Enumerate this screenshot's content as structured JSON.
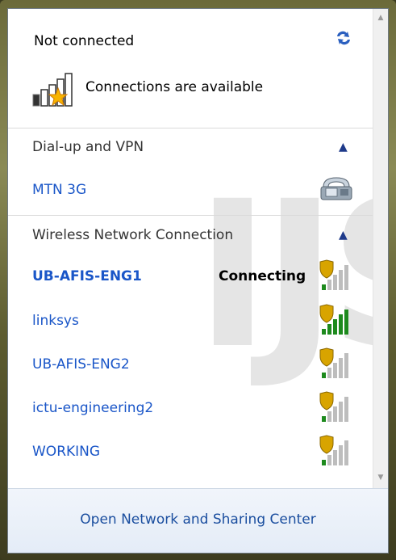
{
  "status": {
    "title": "Not connected",
    "availability_text": "Connections are available"
  },
  "sections": {
    "dialup": {
      "title": "Dial-up and VPN",
      "items": [
        {
          "name": "MTN 3G"
        }
      ]
    },
    "wireless": {
      "title": "Wireless Network Connection",
      "items": [
        {
          "name": "UB-AFIS-ENG1",
          "status": "Connecting",
          "signal_bars": 1,
          "secured": true
        },
        {
          "name": "linksys",
          "signal_bars": 5,
          "secured": true
        },
        {
          "name": "UB-AFIS-ENG2",
          "signal_bars": 1,
          "secured": true
        },
        {
          "name": "ictu-engineering2",
          "signal_bars": 1,
          "secured": true
        },
        {
          "name": "WORKING",
          "signal_bars": 1,
          "secured": true
        }
      ]
    }
  },
  "footer": {
    "link_label": "Open Network and Sharing Center"
  },
  "watermark": "IJS",
  "icons": {
    "refresh": "refresh-icon",
    "connections_available": "signal-star-icon",
    "collapse": "chevron-up-icon",
    "dialup": "phone-modem-icon",
    "wireless_signal": "wifi-signal-shield-icon"
  },
  "colors": {
    "link": "#1a56c8",
    "signal_active": "#1d8a1d",
    "signal_inactive": "#bdbdbd",
    "shield": "#d8a400"
  }
}
